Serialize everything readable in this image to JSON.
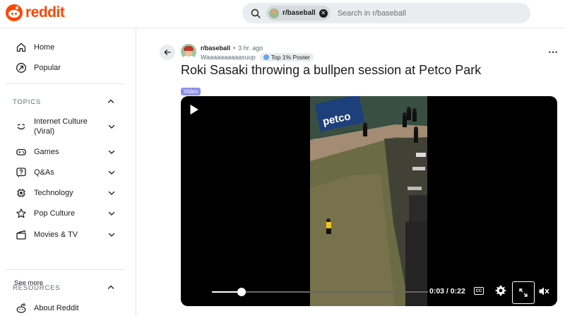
{
  "header": {
    "logo_text": "reddit",
    "search_chip_label": "r/baseball",
    "search_placeholder": "Search in r/baseball",
    "brand_color": "#ff4500"
  },
  "sidebar": {
    "primary": [
      {
        "label": "Home",
        "icon": "home-icon"
      },
      {
        "label": "Popular",
        "icon": "popular-icon"
      }
    ],
    "topics_heading": "TOPICS",
    "topics": [
      {
        "label": "Internet Culture (Viral)",
        "icon": "internet-culture-icon"
      },
      {
        "label": "Games",
        "icon": "gamepad-icon"
      },
      {
        "label": "Q&As",
        "icon": "question-icon"
      },
      {
        "label": "Technology",
        "icon": "chip-icon"
      },
      {
        "label": "Pop Culture",
        "icon": "star-icon"
      },
      {
        "label": "Movies & TV",
        "icon": "clapperboard-icon"
      }
    ],
    "see_more": "See more",
    "resources_heading": "RESOURCES",
    "resources": [
      {
        "label": "About Reddit",
        "icon": "reddit-alien-icon"
      }
    ]
  },
  "post": {
    "subreddit": "r/baseball",
    "time": "3 hr. ago",
    "separator": "•",
    "author": "Waaaaaaaaaasuup",
    "flair": "Top 1% Poster",
    "title": "Roki Sasaki throwing a bullpen session at Petco Park",
    "tag": "Video"
  },
  "video": {
    "time_readout": "0:03 / 0:22",
    "progress_fraction": 0.136,
    "cc_label": "CC",
    "scene_sign_text": "petco"
  }
}
